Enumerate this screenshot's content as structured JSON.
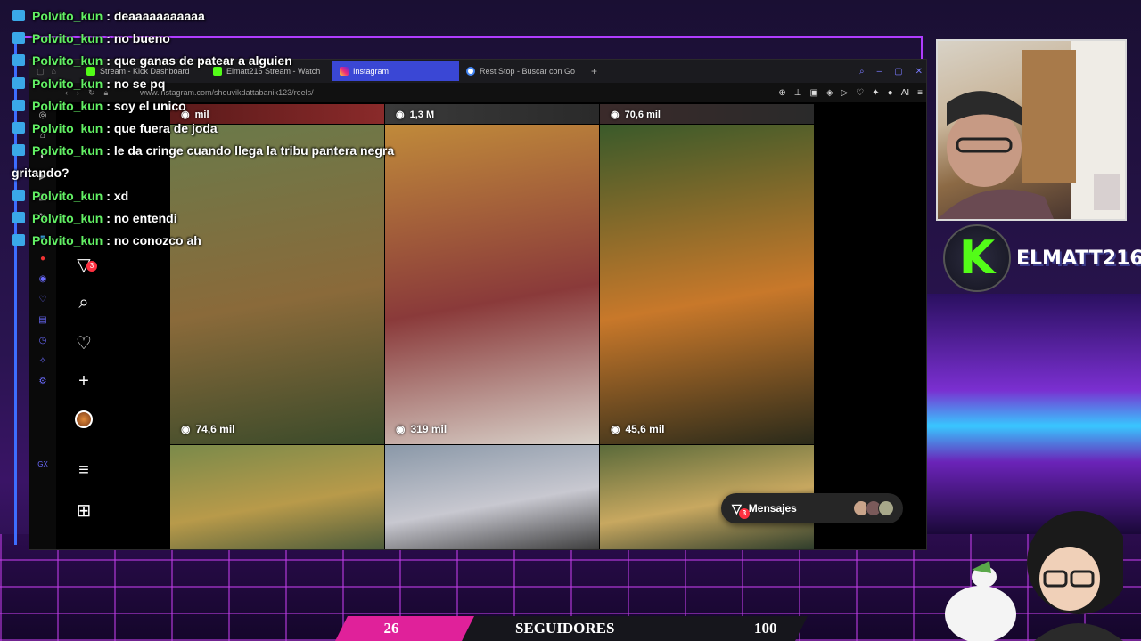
{
  "chat": {
    "messages": [
      {
        "user": "Polvito_kun",
        "text": "deaaaaaaaaaaa"
      },
      {
        "user": "Polvito_kun",
        "text": "no bueno"
      },
      {
        "user": "Polvito_kun",
        "text": "que ganas de patear a alguien"
      },
      {
        "user": "Polvito_kun",
        "text": "no se pq"
      },
      {
        "user": "Polvito_kun",
        "text": "soy el unico"
      },
      {
        "user": "Polvito_kun",
        "text": "que fuera de joda"
      },
      {
        "user": "Polvito_kun",
        "text": "le da cringe cuando llega la tribu pantera negra",
        "text_cont": "gritando?"
      },
      {
        "user": "Polvito_kun",
        "text": "xd"
      },
      {
        "user": "Polvito_kun",
        "text": "no entendi"
      },
      {
        "user": "Polvito_kun",
        "text": "no conozco ah"
      }
    ],
    "separator": " : "
  },
  "browser": {
    "tabs": [
      {
        "label": "Stream - Kick Dashboard",
        "favicon_color": "#53fc18"
      },
      {
        "label": "Elmatt216 Stream - Watch",
        "favicon_color": "#53fc18"
      },
      {
        "label": "Instagram",
        "favicon_color": "#e1306c",
        "active": true
      },
      {
        "label": "Rest Stop - Buscar con Go",
        "favicon_color": "#4285f4"
      }
    ],
    "new_tab": "+",
    "url": "www.instagram.com/shouvikdattabanik123/reels/",
    "ai_label": "AI"
  },
  "instagram": {
    "notification_count": "3",
    "top_row_views": [
      "mil",
      "1,3 M",
      "70,6 mil"
    ],
    "reels": [
      {
        "views": "74,6 mil",
        "colors": [
          "#6a7a4a",
          "#8a6a3a",
          "#3a4a2a"
        ]
      },
      {
        "views": "319 mil",
        "colors": [
          "#c08a3a",
          "#8a3a3a",
          "#d8d0c8"
        ]
      },
      {
        "views": "45,6 mil",
        "colors": [
          "#3a5a2a",
          "#c8782a",
          "#2a2a1a"
        ]
      },
      {
        "colors": [
          "#7a8a4a",
          "#b89a4a",
          "#4a5a3a"
        ]
      },
      {
        "colors": [
          "#8a98a8",
          "#c8c8d0",
          "#3a3a3a"
        ]
      },
      {
        "colors": [
          "#5a6a3a",
          "#c8a860",
          "#2a3a2a"
        ]
      }
    ],
    "messages_label": "Mensajes",
    "messages_badge": "3"
  },
  "channel": {
    "name": "ELMATT216",
    "logo_letter": "K"
  },
  "followers": {
    "current": "26",
    "label": "SEGUIDORES",
    "goal": "100",
    "progress": 0.26
  },
  "colors": {
    "kick_green": "#53fc18",
    "chat_username": "#62f064",
    "followers_pink": "#e0219a",
    "accent_purple": "#b03cff",
    "active_tab": "#3a47d5"
  }
}
